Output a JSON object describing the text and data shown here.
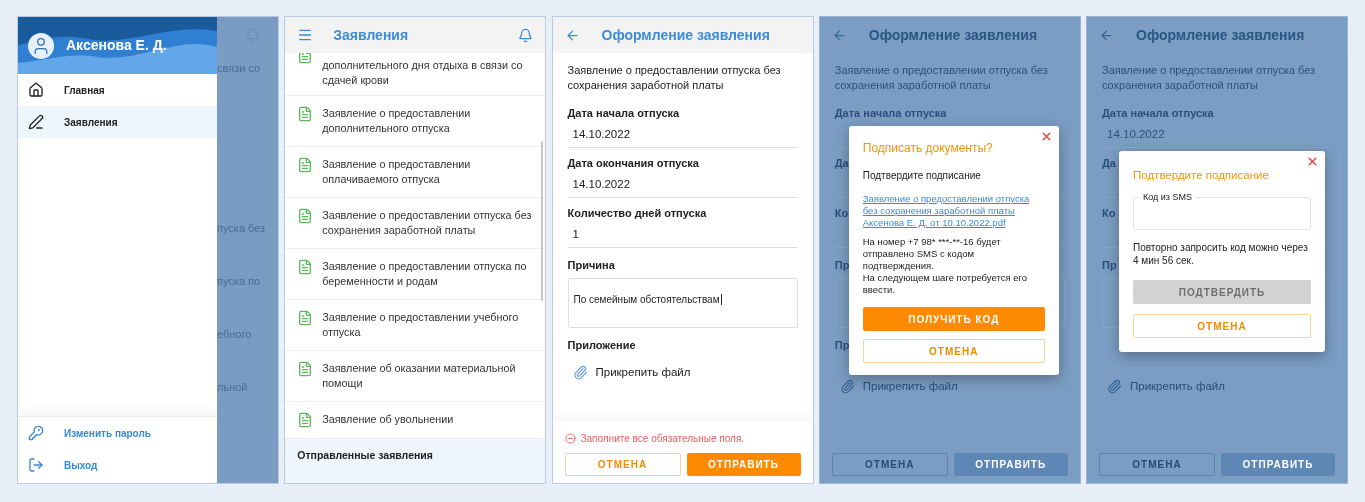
{
  "screens": [
    {
      "kind": "drawer",
      "user_name": "Аксенова Е. Д.",
      "menu": [
        {
          "label": "Главная",
          "selected": false
        },
        {
          "label": "Заявления",
          "selected": true
        }
      ],
      "footer_menu": [
        "Изменить пароль",
        "Выход"
      ],
      "behind_fragments": [
        "связи со",
        "пуска без",
        "пуска по",
        "ебного",
        "льной"
      ]
    },
    {
      "kind": "list",
      "title": "Заявления",
      "items": [
        "дополнительного дня отдыха в связи со сдачей крови",
        "Заявление о предоставлении дополнительного отпуска",
        "Заявление о предоставлении оплачиваемого отпуска",
        "Заявление о предоставлении отпуска без сохранения заработной платы",
        "Заявление о предоставлении отпуска по беременности и родам",
        "Заявление о предоставлении учебного отпуска",
        "Заявление об оказании материальной помощи",
        "Заявление об увольнении"
      ],
      "section_title": "Отправленные заявления"
    },
    {
      "kind": "form",
      "dimmed": false,
      "title": "Оформление заявления",
      "description": "Заявление о предоставлении отпуска без сохранения заработной платы",
      "fields": [
        {
          "label": "Дата начала отпуска",
          "value": "14.10.2022"
        },
        {
          "label": "Дата окончания отпуска",
          "value": "14.10.2022"
        },
        {
          "label": "Количество дней отпуска",
          "value": "1"
        }
      ],
      "reason": {
        "label": "Причина",
        "value": "По семейным обстоятельствам"
      },
      "attachment": {
        "label": "Приложение",
        "link": "Прикрепить файл"
      },
      "error": "Заполните все обязательные поля.",
      "buttons": [
        {
          "label": "ОТМЕНА",
          "kind": "outline"
        },
        {
          "label": "ОТПРАВИТЬ",
          "kind": "primary"
        }
      ]
    },
    {
      "kind": "form",
      "dimmed": true,
      "title": "Оформление заявления",
      "description": "Заявление о предоставлении отпуска без сохранения заработной платы",
      "fields": [
        {
          "label": "Дата начала отпуска"
        },
        {
          "label": "Да"
        },
        {
          "label": "Ко"
        }
      ],
      "reason": {
        "label": "Пр"
      },
      "attachment": {
        "label": "Пр",
        "link": "Прикрепить файл"
      },
      "buttons": [
        {
          "label": "ОТМЕНА",
          "kind": "outline"
        },
        {
          "label": "ОТПРАВИТЬ",
          "kind": "primary"
        }
      ],
      "dialog": {
        "kind": "sign",
        "title": "Подписать документы?",
        "subtitle": "Подтвердите подписание",
        "link": "Заявление о предоставлении отпуска без сохранения заработной платы Аксенова Е. Д. от 10.10.2022.pdf",
        "paragraphs": [
          "На номер +7 98* ***-**-16 будет отправлено SMS с кодом подтверждения.",
          "На следующем шаге потребуется его ввести."
        ],
        "buttons": [
          {
            "label": "ПОЛУЧИТЬ КОД",
            "kind": "primary",
            "disabled": false
          },
          {
            "label": "ОТМЕНА",
            "kind": "outline",
            "disabled": false
          }
        ]
      }
    },
    {
      "kind": "form",
      "dimmed": true,
      "title": "Оформление заявления",
      "description": "Заявление о предоставлении отпуска без сохранения заработной платы",
      "fields": [
        {
          "label": "Дата начала отпуска",
          "value": "14.10.2022"
        },
        {
          "label": "Да"
        },
        {
          "label": "Ко"
        }
      ],
      "reason": {
        "label": "Пр"
      },
      "attachment": {
        "link": "Прикрепить файл"
      },
      "buttons": [
        {
          "label": "ОТМЕНА",
          "kind": "outline"
        },
        {
          "label": "ОТПРАВИТЬ",
          "kind": "primary"
        }
      ],
      "dialog": {
        "kind": "code",
        "title": "Подтвердите подписание",
        "field_label": "Код из SMS",
        "note": "Повторно запросить код можно через 4 мин 56 сек.",
        "buttons": [
          {
            "label": "ПОДТВЕРДИТЬ",
            "kind": "primary",
            "disabled": true
          },
          {
            "label": "ОТМЕНА",
            "kind": "outline",
            "disabled": false
          }
        ]
      }
    }
  ]
}
